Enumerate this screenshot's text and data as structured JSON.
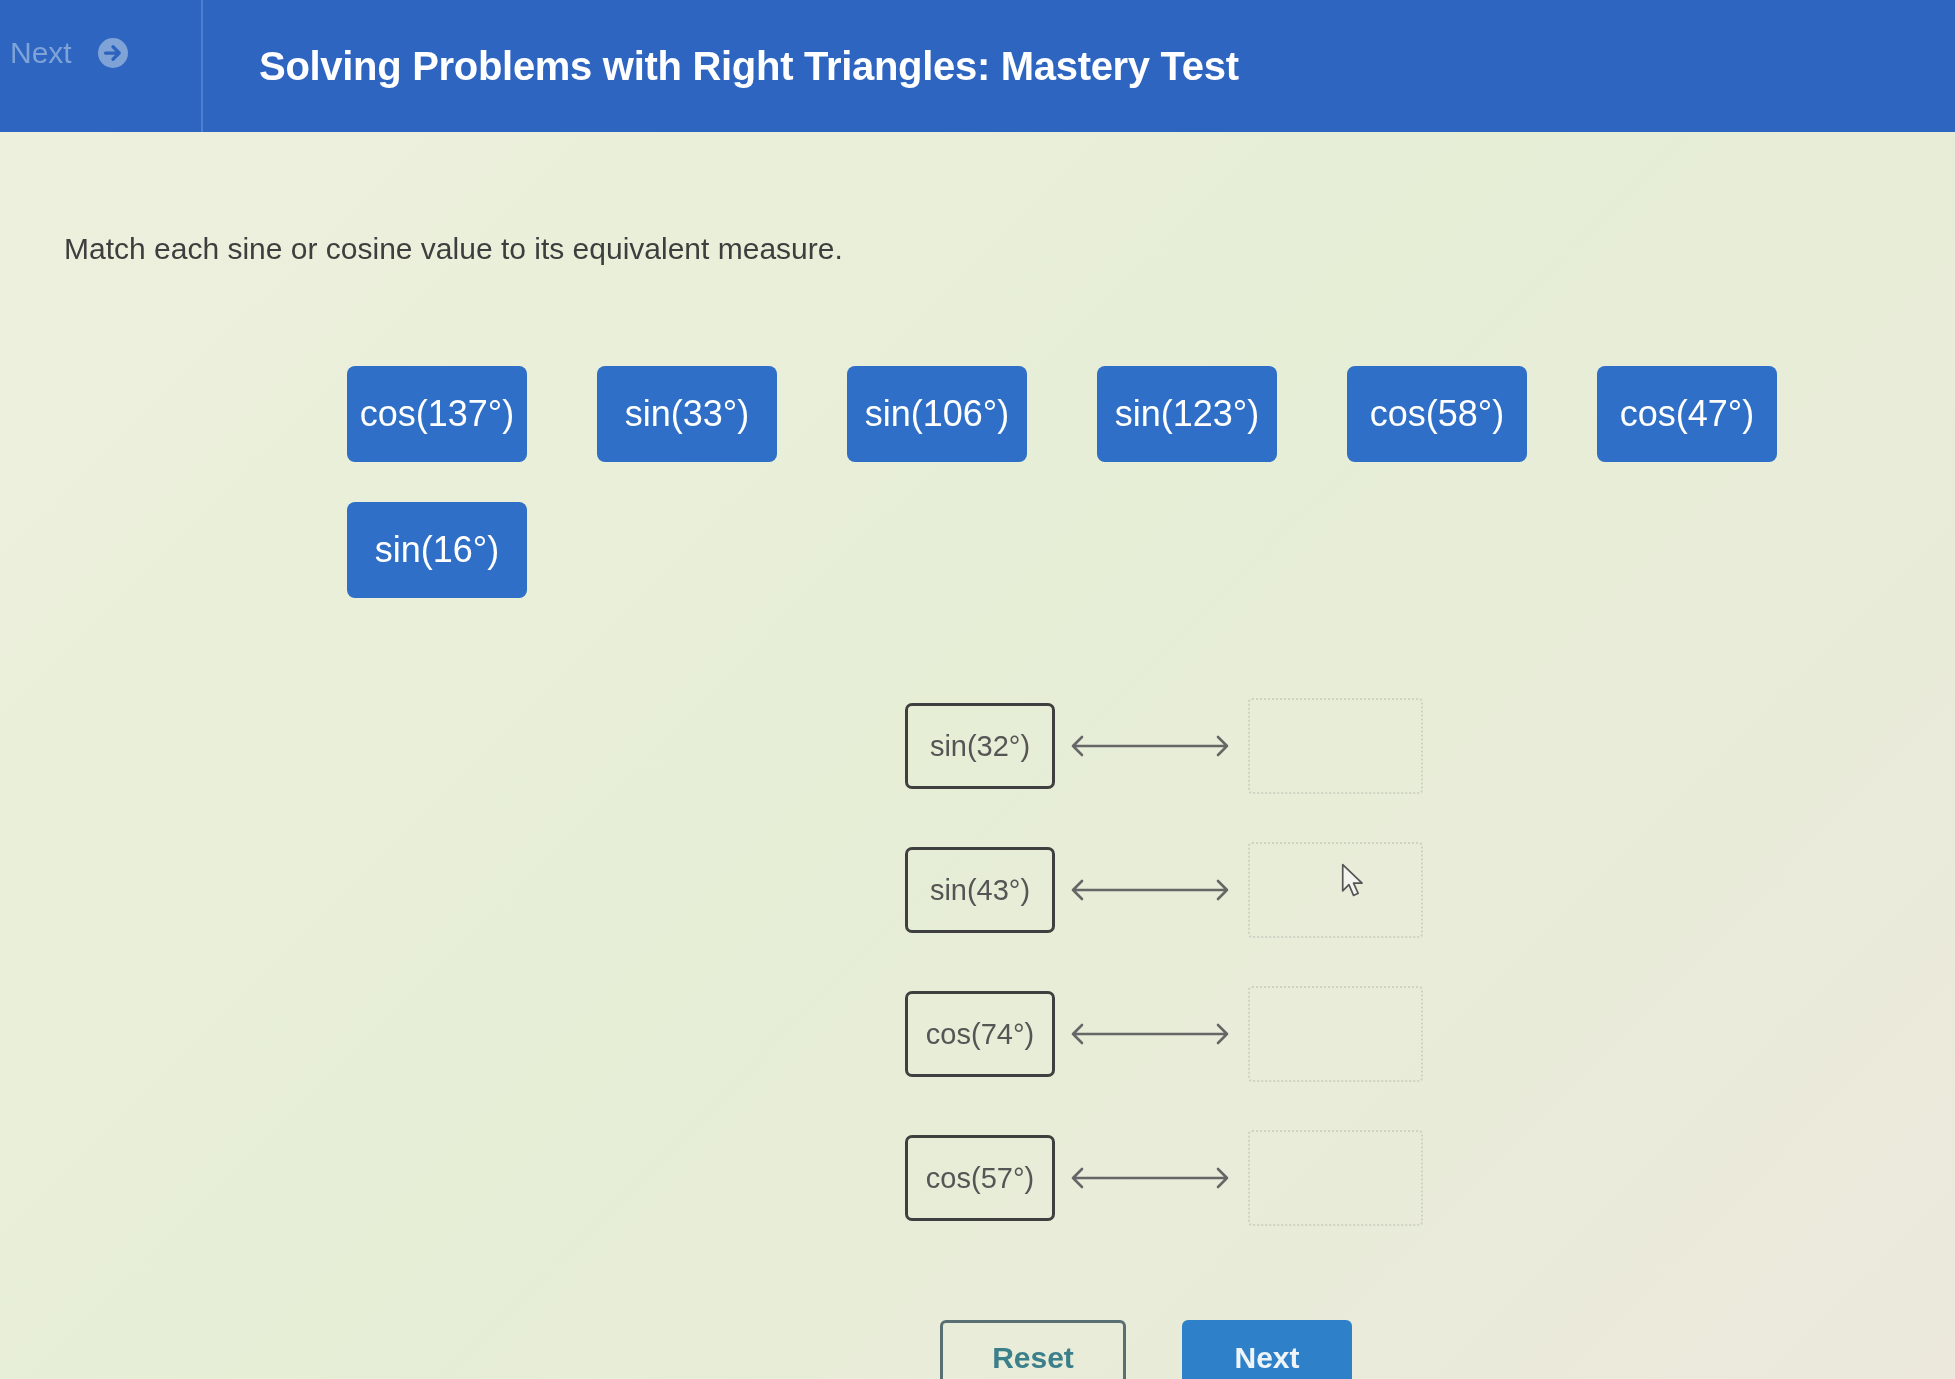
{
  "header": {
    "nav": {
      "label": "Next",
      "disabled": true
    },
    "title": "Solving Problems with Right Triangles: Mastery Test"
  },
  "instruction": "Match each sine or cosine value to its equivalent measure.",
  "tiles": [
    "cos(137°)",
    "sin(33°)",
    "sin(106°)",
    "sin(123°)",
    "cos(58°)",
    "cos(47°)",
    "sin(16°)"
  ],
  "pairs": [
    {
      "prompt": "sin(32°)"
    },
    {
      "prompt": "sin(43°)"
    },
    {
      "prompt": "cos(74°)"
    },
    {
      "prompt": "cos(57°)"
    }
  ],
  "buttons": [
    {
      "label": "Reset",
      "kind": "secondary"
    },
    {
      "label": "Next",
      "kind": "primary"
    }
  ]
}
